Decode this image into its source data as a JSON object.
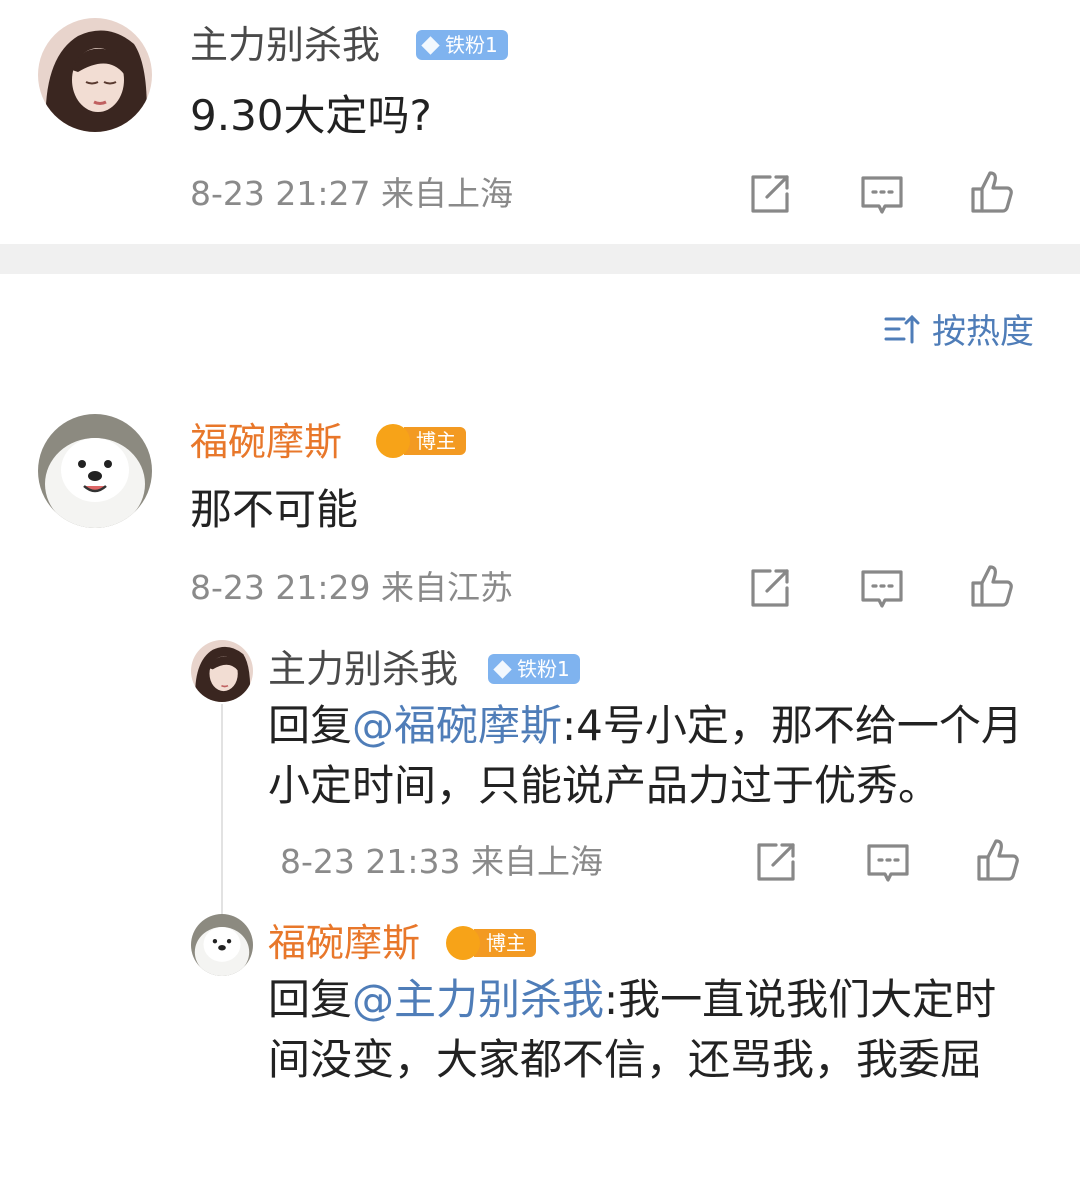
{
  "post": {
    "username": "主力别杀我",
    "badge": "铁粉1",
    "text": "9.30大定吗?",
    "meta": "8-23 21:27 来自上海"
  },
  "sort": {
    "label": "按热度",
    "icon": "sort-icon"
  },
  "comments": [
    {
      "username": "福碗摩斯",
      "badge": "博主",
      "text": "那不可能",
      "meta": "8-23 21:29 来自江苏",
      "replies": [
        {
          "username": "主力别杀我",
          "badge": "铁粉1",
          "reply_prefix": "回复",
          "mention": "@福碗摩斯",
          "text": ":4号小定，那不给一个月小定时间，只能说产品力过于优秀。",
          "meta": "8-23 21:33 来自上海"
        },
        {
          "username": "福碗摩斯",
          "badge": "博主",
          "reply_prefix": "回复",
          "mention": "@主力别杀我",
          "text": ":我一直说我们大定时间没变，大家都不信，还骂我，我委屈"
        }
      ]
    }
  ],
  "icons": {
    "share": "share-icon",
    "comment": "comment-icon",
    "like": "like-icon"
  },
  "colors": {
    "accent_link": "#4f7db8",
    "blogger_name": "#e8772a",
    "fan_badge": "#7fb3ef",
    "blogger_badge": "#f39a22",
    "meta_text": "#8a8a8a"
  }
}
